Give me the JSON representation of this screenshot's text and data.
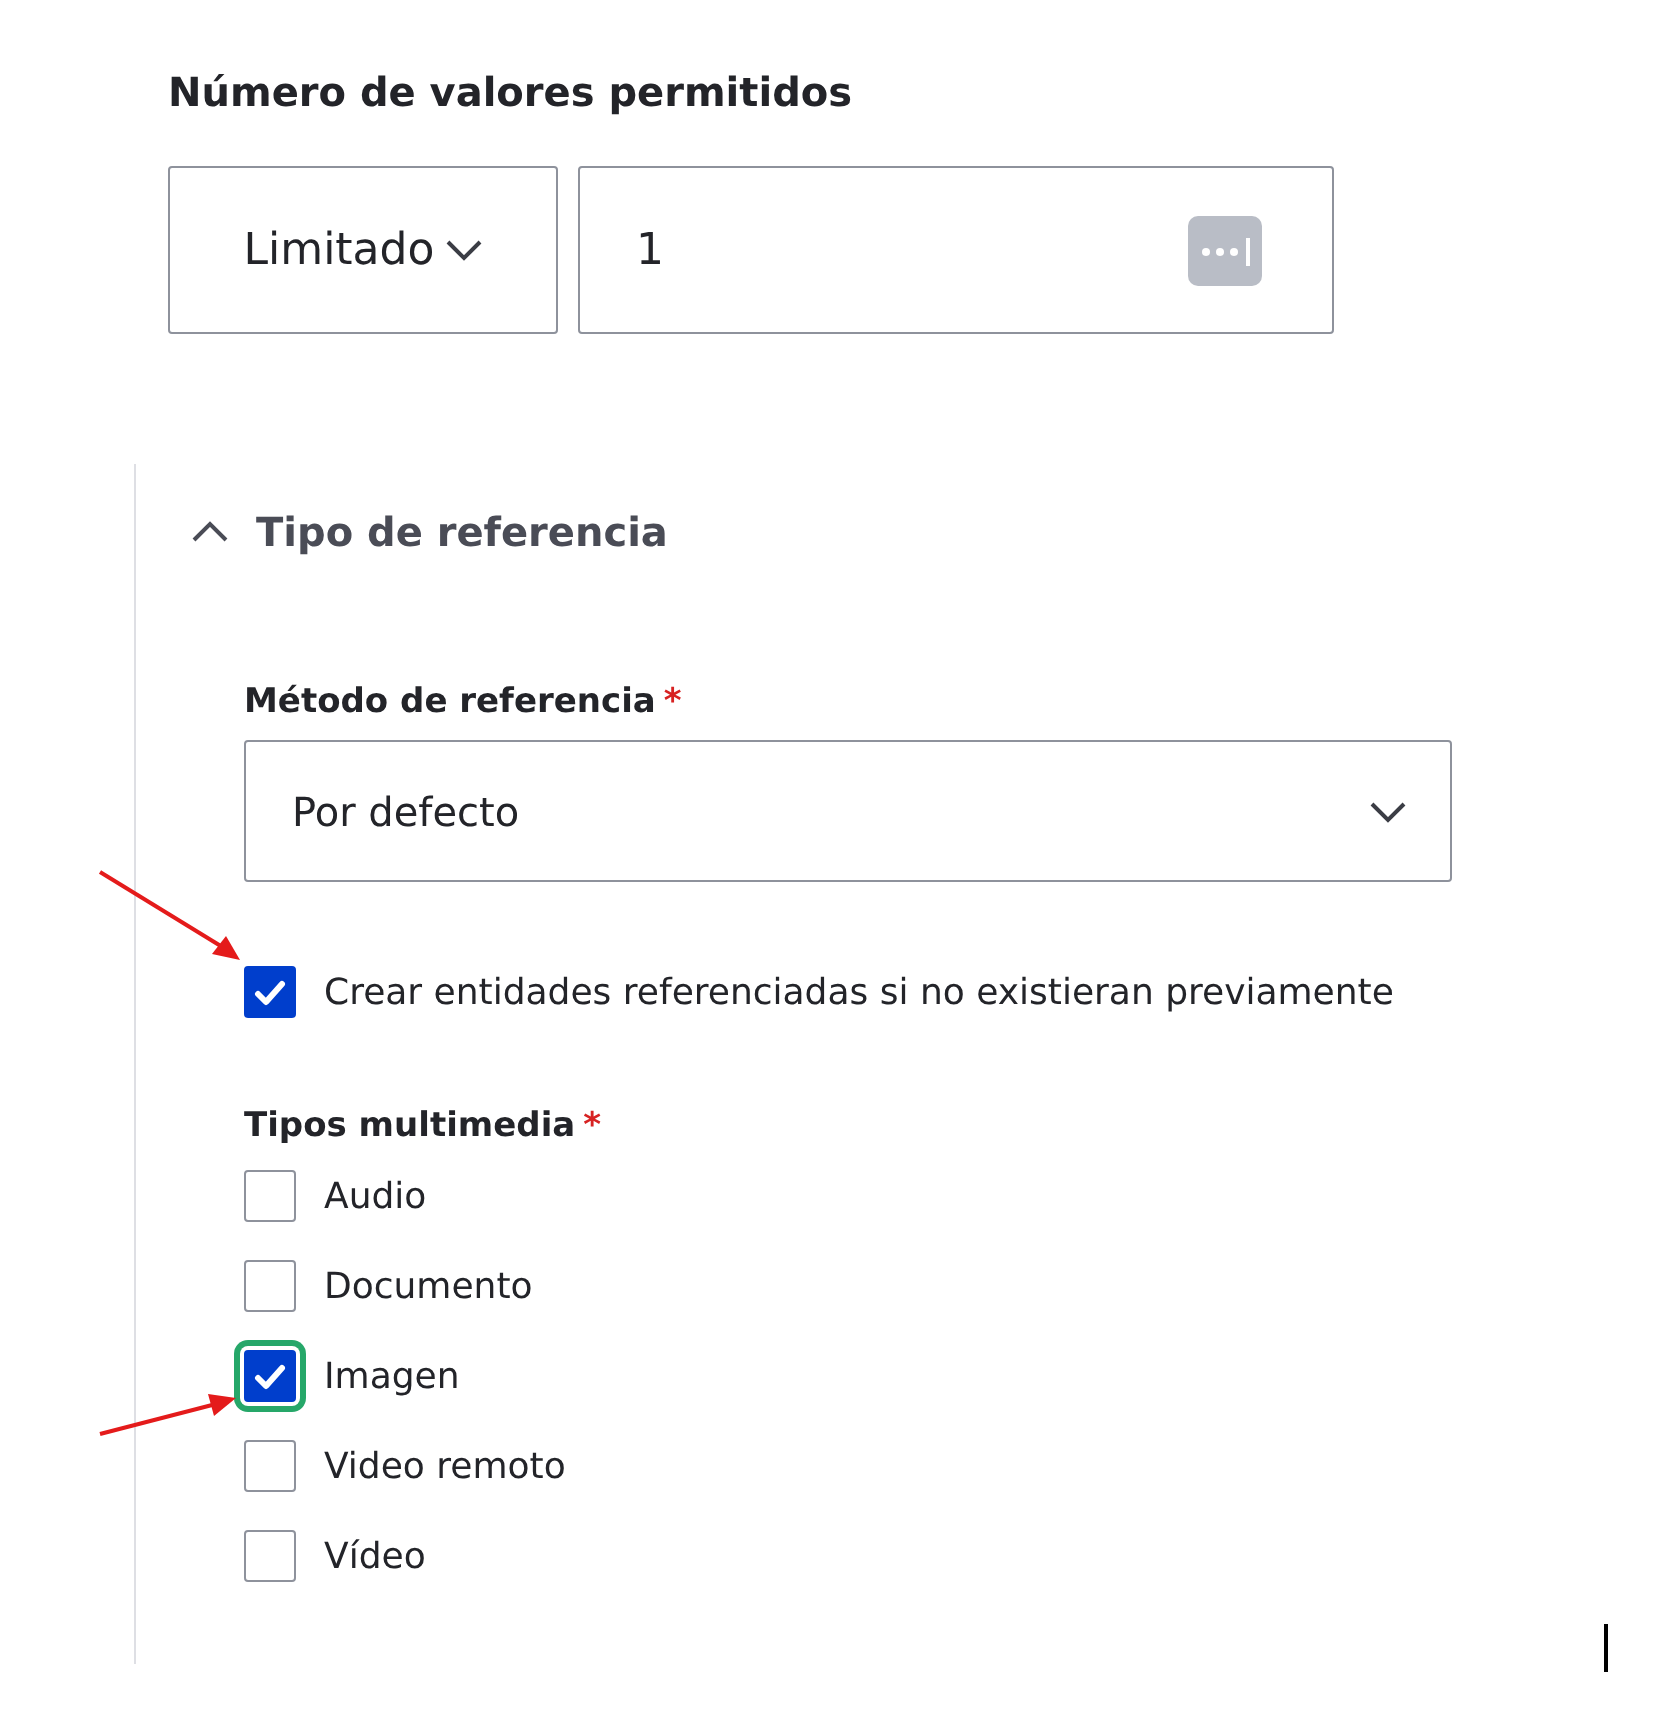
{
  "allowed_values": {
    "label": "Número de valores permitidos",
    "mode_select": {
      "value": "Limitado"
    },
    "count_field": {
      "value": "1"
    }
  },
  "reference_section": {
    "title": "Tipo de referencia",
    "expanded": true,
    "method": {
      "label": "Método de referencia",
      "required_mark": "*",
      "value": "Por defecto"
    },
    "create_referenced": {
      "label": "Crear entidades referenciadas si no existieran previamente",
      "checked": true,
      "focused": false
    },
    "media_types": {
      "label": "Tipos multimedia",
      "required_mark": "*",
      "options": [
        {
          "label": "Audio",
          "checked": false,
          "focused": false
        },
        {
          "label": "Documento",
          "checked": false,
          "focused": false
        },
        {
          "label": "Imagen",
          "checked": true,
          "focused": true
        },
        {
          "label": "Video remoto",
          "checked": false,
          "focused": false
        },
        {
          "label": "Vídeo",
          "checked": false,
          "focused": false
        }
      ]
    }
  }
}
